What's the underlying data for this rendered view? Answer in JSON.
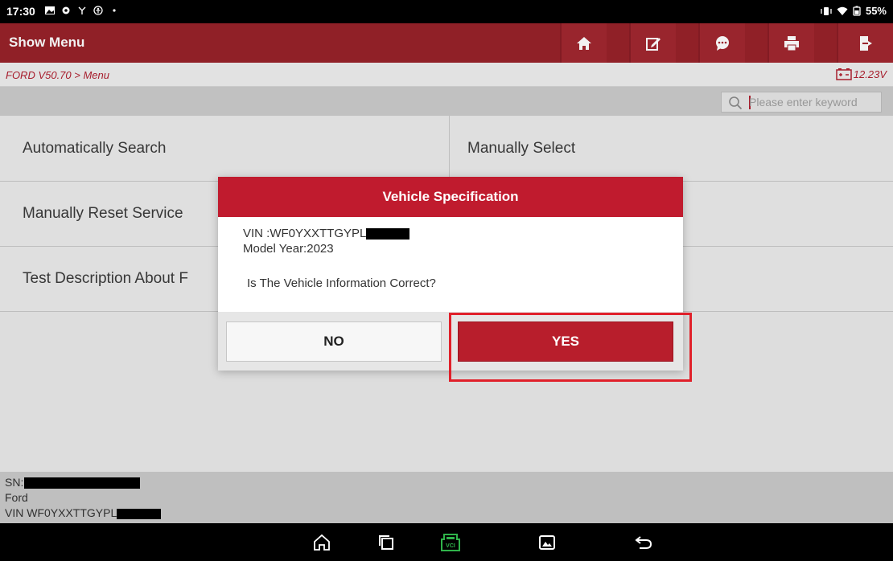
{
  "status_bar": {
    "time": "17:30",
    "battery": "55%"
  },
  "title_bar": {
    "title": "Show Menu",
    "buttons": [
      {
        "name": "home-icon"
      },
      {
        "name": "edit-icon"
      },
      {
        "name": "chat-icon"
      },
      {
        "name": "print-icon"
      },
      {
        "name": "exit-icon"
      }
    ]
  },
  "breadcrumb": {
    "path": "FORD V50.70 > Menu",
    "voltage": "12.23V"
  },
  "search": {
    "placeholder": "Please enter keyword"
  },
  "menu": {
    "items": [
      "Automatically Search",
      "Manually Select",
      "Manually Reset Service",
      "",
      "Test Description About F",
      ""
    ]
  },
  "dialog": {
    "title": "Vehicle Specification",
    "vin_line": "VIN :WF0YXXTTGYPL",
    "model_year_line": "Model Year:2023",
    "question": "Is The Vehicle Information Correct?",
    "no_label": "NO",
    "yes_label": "YES"
  },
  "footer_info": {
    "sn_label": "SN:",
    "make": "Ford",
    "vin": "VIN WF0YXXTTGYPL"
  },
  "colors": {
    "brand_red": "#c01b2e",
    "title_bar": "#98222a",
    "accent_green": "#2fb34a"
  }
}
